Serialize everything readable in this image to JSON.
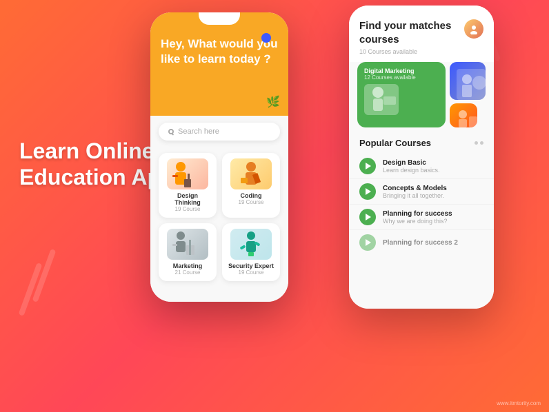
{
  "background": {
    "gradient_start": "#ff6b35",
    "gradient_end": "#ff4757"
  },
  "hero": {
    "title_line1": "Learn Online",
    "title_line2": "Education App"
  },
  "phone_left": {
    "header_text": "Hey, What would you like to learn today ?",
    "search_placeholder": "Search here",
    "categories": [
      {
        "name": "Design Thinking",
        "count": "19 Course",
        "color": "cat-design"
      },
      {
        "name": "Coding",
        "count": "19 Course",
        "color": "cat-coding"
      },
      {
        "name": "Marketing",
        "count": "21 Course",
        "color": "cat-marketing"
      },
      {
        "name": "Security Expert",
        "count": "19 Course",
        "color": "cat-security"
      }
    ]
  },
  "phone_right": {
    "title": "Find your matches courses",
    "subtitle": "10 Courses available",
    "featured_course": {
      "name": "Digital Marketing",
      "count": "12 Courses available"
    },
    "popular_section_title": "Popular Courses",
    "courses": [
      {
        "title": "Design Basic",
        "subtitle": "Learn design basics."
      },
      {
        "title": "Concepts & Models",
        "subtitle": "Bringing it all together."
      },
      {
        "title": "Planning for success",
        "subtitle": "Why we are doing this?"
      },
      {
        "title": "Planning for success 2",
        "subtitle": ""
      }
    ]
  },
  "watermark": "www.itmtority.com"
}
